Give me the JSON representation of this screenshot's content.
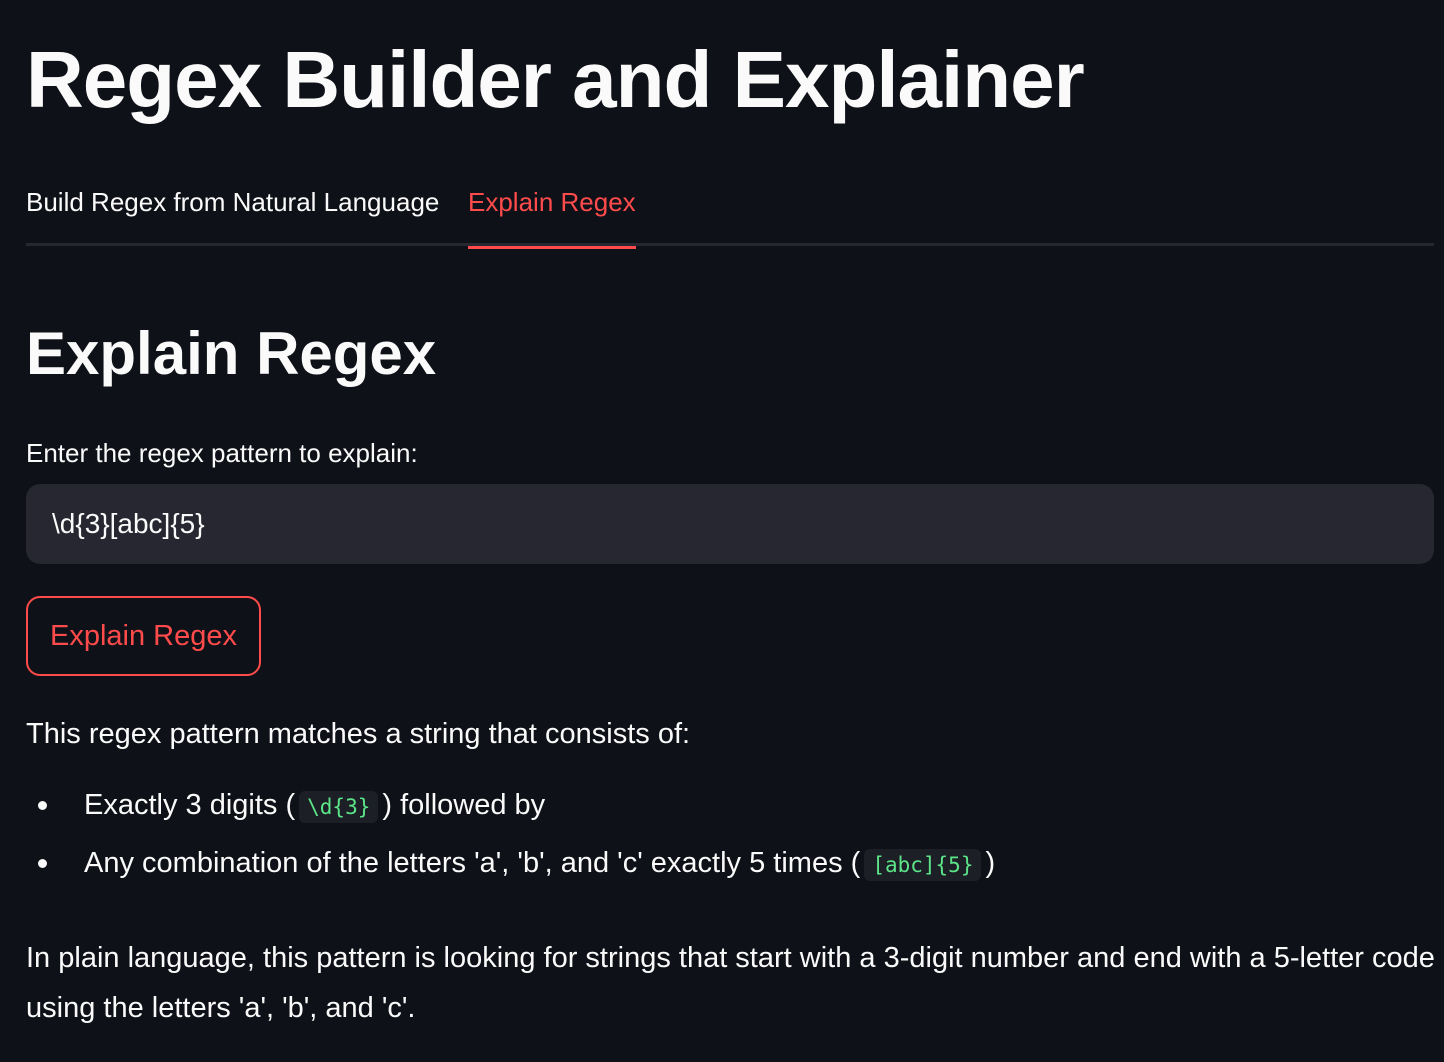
{
  "header": {
    "title": "Regex Builder and Explainer"
  },
  "tabs": [
    {
      "label": "Build Regex from Natural Language",
      "active": false
    },
    {
      "label": "Explain Regex",
      "active": true
    }
  ],
  "main": {
    "section_title": "Explain Regex",
    "input_label": "Enter the regex pattern to explain:",
    "input_value": "\\d{3}[abc]{5}",
    "button_label": "Explain Regex",
    "result": {
      "intro": "This regex pattern matches a string that consists of:",
      "items": [
        {
          "before": "Exactly 3 digits (",
          "code": "\\d{3}",
          "after": ") followed by"
        },
        {
          "before": "Any combination of the letters 'a', 'b', and 'c' exactly 5 times (",
          "code": "[abc]{5}",
          "after": ")"
        }
      ],
      "summary": "In plain language, this pattern is looking for strings that start with a 3-digit number and end with a 5-letter code using the letters 'a', 'b', and 'c'."
    }
  },
  "colors": {
    "background": "#0e1117",
    "accent": "#ff4b4b",
    "input_bg": "#262730",
    "code_text": "#5ce488"
  }
}
